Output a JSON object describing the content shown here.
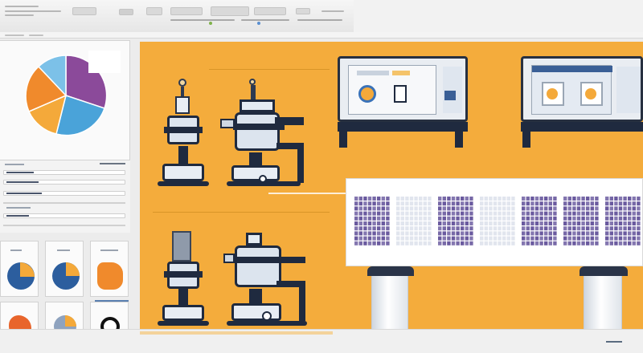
{
  "toolbar": {
    "icons": [
      "menu-icon",
      "window-icon",
      "settings-icon"
    ]
  },
  "left_panel": {
    "pie_chart": {
      "colors": [
        "#8b4a9a",
        "#4aa3d9",
        "#f4a93a",
        "#f08a2c",
        "#7cc1e8"
      ],
      "legend_colors": [
        "#8b4a9a",
        "#4aa3d9",
        "#f4a93a"
      ]
    },
    "thumbnails": [
      {
        "icon": "circle-chart-icon",
        "color": "#2c5e9e"
      },
      {
        "icon": "circle-chart-icon",
        "color": "#2c5e9e"
      },
      {
        "icon": "blob-icon",
        "color": "#f08a2c"
      },
      {
        "icon": "blob-icon",
        "color": "#e8652c"
      },
      {
        "icon": "circle-chart-icon",
        "color": "#8fa3bf"
      },
      {
        "icon": "ring-icon",
        "color": "#111111"
      }
    ]
  },
  "canvas": {
    "background": "#f4ac3c",
    "machines": [
      "microscope-icon",
      "coffee-machine-icon",
      "microscope-icon",
      "coffee-machine-icon"
    ],
    "monitors": [
      "monitor-icon",
      "monitor-icon"
    ],
    "conveyor_color": "#5b4a95"
  }
}
